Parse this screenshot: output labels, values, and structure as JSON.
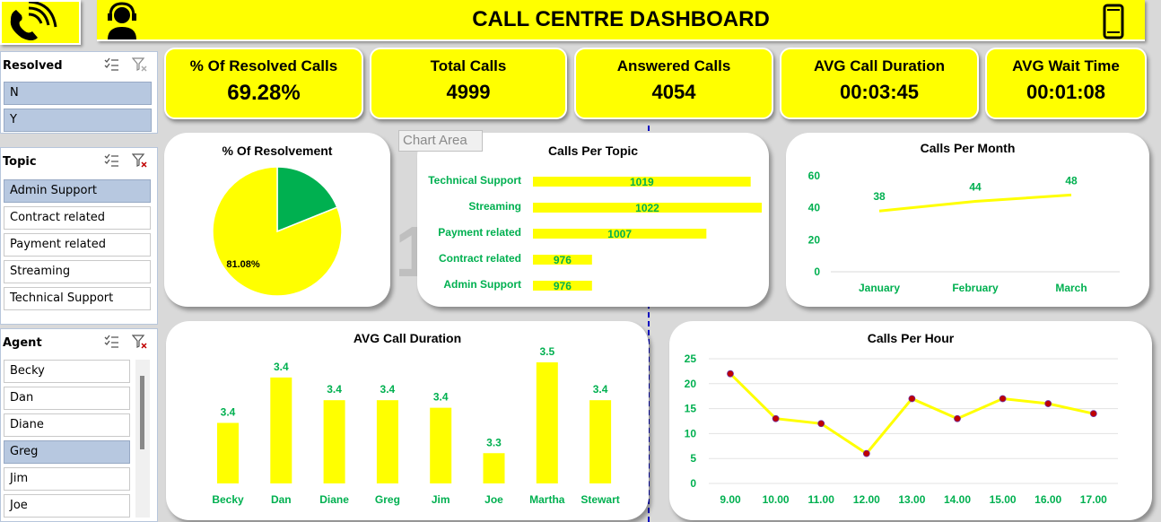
{
  "header": {
    "title": "CALL CENTRE DASHBOARD"
  },
  "kpis": [
    {
      "label": "% Of Resolved Calls",
      "value": "69.28%"
    },
    {
      "label": "Total Calls",
      "value": "4999"
    },
    {
      "label": "Answered Calls",
      "value": "4054"
    },
    {
      "label": "AVG Call Duration",
      "value": "00:03:45"
    },
    {
      "label": "AVG Wait Time",
      "value": "00:01:08"
    }
  ],
  "slicers": {
    "resolved": {
      "title": "Resolved",
      "items": [
        {
          "label": "N",
          "selected": true
        },
        {
          "label": "Y",
          "selected": true
        }
      ]
    },
    "topic": {
      "title": "Topic",
      "items": [
        {
          "label": "Admin Support",
          "selected": true
        },
        {
          "label": "Contract related",
          "selected": false
        },
        {
          "label": "Payment related",
          "selected": false
        },
        {
          "label": "Streaming",
          "selected": false
        },
        {
          "label": "Technical Support",
          "selected": false
        }
      ]
    },
    "agent": {
      "title": "Agent",
      "items": [
        {
          "label": "Becky",
          "selected": false
        },
        {
          "label": "Dan",
          "selected": false
        },
        {
          "label": "Diane",
          "selected": false
        },
        {
          "label": "Greg",
          "selected": true
        },
        {
          "label": "Jim",
          "selected": false
        },
        {
          "label": "Joe",
          "selected": false
        }
      ]
    }
  },
  "tooltip": {
    "chart_area": "Chart Area"
  },
  "colors": {
    "yellow": "#ffff00",
    "green": "#00b050",
    "marker": "#c00000",
    "slicer_selected": "#b7c8e0"
  },
  "icons": [
    "phone-icon",
    "agent-headset-icon",
    "mobile-phone-icon",
    "multi-select-icon",
    "clear-filter-icon"
  ],
  "chart_data": [
    {
      "id": "resolvement",
      "type": "pie",
      "title": "% Of Resolvement",
      "slices": [
        {
          "label": "18.92%",
          "value": 18.92,
          "color": "#00b050"
        },
        {
          "label": "81.08%",
          "value": 81.08,
          "color": "#ffff00"
        }
      ]
    },
    {
      "id": "calls_per_topic",
      "type": "bar",
      "orientation": "horizontal",
      "title": "Calls Per Topic",
      "categories": [
        "Technical Support",
        "Streaming",
        "Payment related",
        "Contract related",
        "Admin Support"
      ],
      "values": [
        1019,
        1022,
        1007,
        976,
        976
      ]
    },
    {
      "id": "calls_per_month",
      "type": "line",
      "title": "Calls Per Month",
      "categories": [
        "January",
        "February",
        "March"
      ],
      "values": [
        38,
        44,
        48
      ],
      "ylim": [
        0,
        60
      ],
      "yticks": [
        0,
        20,
        40,
        60
      ]
    },
    {
      "id": "avg_call_duration",
      "type": "bar",
      "title": "AVG Call Duration",
      "categories": [
        "Becky",
        "Dan",
        "Diane",
        "Greg",
        "Jim",
        "Joe",
        "Martha",
        "Stewart"
      ],
      "values": [
        3.36,
        3.42,
        3.39,
        3.39,
        3.38,
        3.32,
        3.44,
        3.39
      ],
      "labels": [
        "3.4",
        "3.4",
        "3.4",
        "3.4",
        "3.4",
        "3.3",
        "3.5",
        "3.4"
      ]
    },
    {
      "id": "calls_per_hour",
      "type": "line",
      "title": "Calls Per Hour",
      "categories": [
        "9.00",
        "10.00",
        "11.00",
        "12.00",
        "13.00",
        "14.00",
        "15.00",
        "16.00",
        "17.00"
      ],
      "values": [
        22,
        13,
        12,
        6,
        17,
        13,
        17,
        16,
        14
      ],
      "ylim": [
        0,
        25
      ],
      "yticks": [
        0,
        5,
        10,
        15,
        20,
        25
      ]
    }
  ]
}
